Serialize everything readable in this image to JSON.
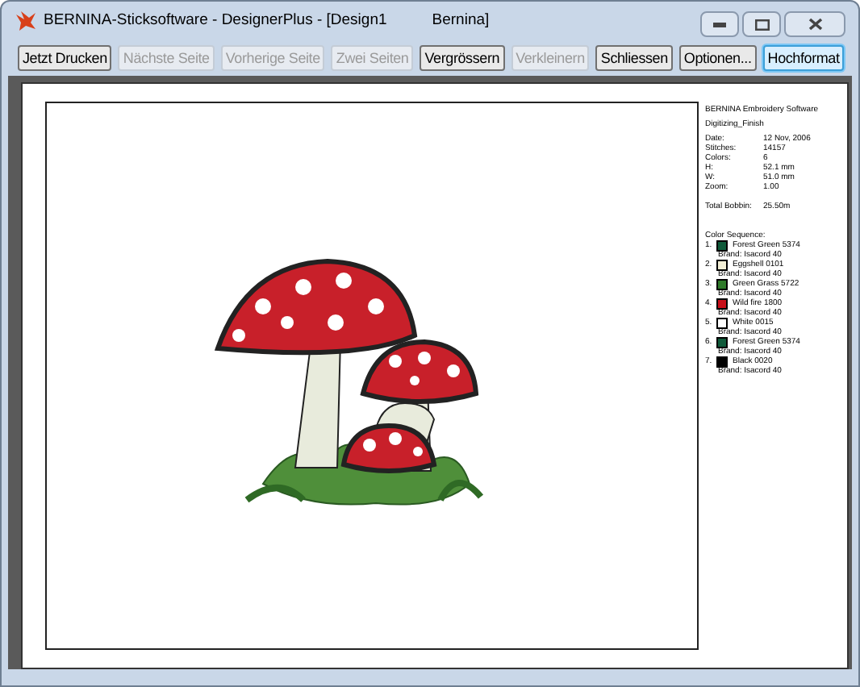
{
  "window": {
    "title": "BERNINA-Sticksoftware - DesignerPlus - [Design1",
    "title_extra": "Bernina]"
  },
  "toolbar": [
    {
      "label": "Jetzt Drucken",
      "disabled": false,
      "selected": false
    },
    {
      "label": "Nächste Seite",
      "disabled": true,
      "selected": false
    },
    {
      "label": "Vorherige Seite",
      "disabled": true,
      "selected": false
    },
    {
      "label": "Zwei Seiten",
      "disabled": true,
      "selected": false
    },
    {
      "label": "Vergrössern",
      "disabled": false,
      "selected": false
    },
    {
      "label": "Verkleinern",
      "disabled": true,
      "selected": false
    },
    {
      "label": "Schliessen",
      "disabled": false,
      "selected": false
    },
    {
      "label": "Optionen...",
      "disabled": false,
      "selected": false
    },
    {
      "label": "Hochformat",
      "disabled": false,
      "selected": true
    }
  ],
  "info": {
    "heading": "BERNINA Embroidery Software",
    "design": "Digitizing_Finish",
    "stats": [
      {
        "label": "Date:",
        "value": "12 Nov, 2006"
      },
      {
        "label": "Stitches:",
        "value": "14157"
      },
      {
        "label": "Colors:",
        "value": "6"
      },
      {
        "label": "H:",
        "value": "52.1 mm"
      },
      {
        "label": "W:",
        "value": "51.0 mm"
      },
      {
        "label": "Zoom:",
        "value": "1.00"
      }
    ],
    "bobbin": {
      "label": "Total Bobbin:",
      "value": "25.50m"
    },
    "sequence_title": "Color Sequence:",
    "colors": [
      {
        "number": "1.",
        "name": "Forest Green 5374",
        "brand": "Brand: Isacord 40",
        "color": "#0f5a3a"
      },
      {
        "number": "2.",
        "name": "Eggshell 0101",
        "brand": "Brand: Isacord 40",
        "color": "#f3efd6"
      },
      {
        "number": "3.",
        "name": "Green Grass 5722",
        "brand": "Brand: Isacord 40",
        "color": "#2f7a2a"
      },
      {
        "number": "4.",
        "name": "Wild fire 1800",
        "brand": "Brand: Isacord 40",
        "color": "#c8101a"
      },
      {
        "number": "5.",
        "name": "White 0015",
        "brand": "Brand: Isacord 40",
        "color": "#ffffff"
      },
      {
        "number": "6.",
        "name": "Forest Green 5374",
        "brand": "Brand: Isacord 40",
        "color": "#0f5a3a"
      },
      {
        "number": "7.",
        "name": "Black 0020",
        "brand": "Brand: Isacord 40",
        "color": "#000000"
      }
    ]
  }
}
